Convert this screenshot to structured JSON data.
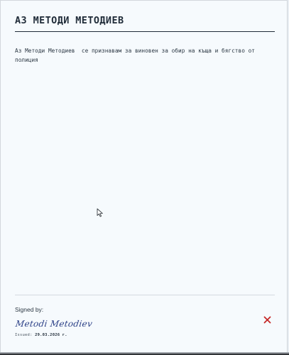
{
  "document": {
    "title": "АЗ МЕТОДИ МЕТОДИЕВ",
    "body": "Аз Методи Методиев  се признавам за виновен за обир на къща и бягство от полиция"
  },
  "footer": {
    "signed_label": "Signed by:",
    "signature": "Metodi Metodiev",
    "issued_label": "Issued:",
    "issued_date": "29.03.2026 г."
  },
  "colors": {
    "close_icon": "#c62828",
    "signature_ink": "#2a3f86"
  },
  "icons": {
    "close": "close-icon",
    "cursor": "mouse-pointer-icon"
  }
}
